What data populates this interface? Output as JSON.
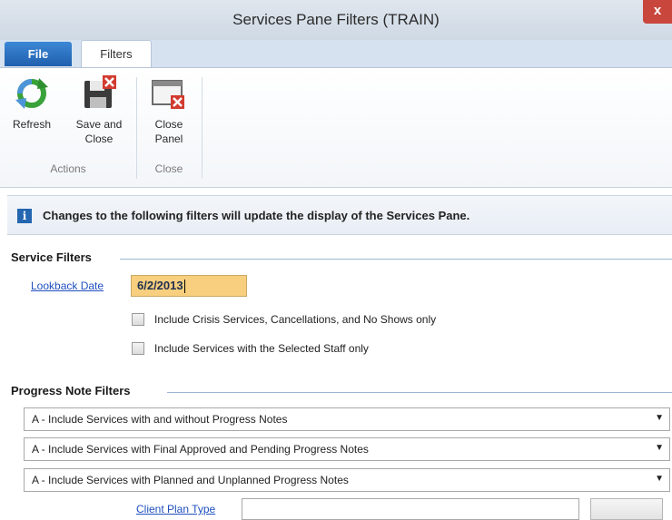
{
  "window": {
    "title": "Services Pane Filters (TRAIN)",
    "close_glyph": "x"
  },
  "tabs": [
    {
      "label": "File"
    },
    {
      "label": "Filters"
    }
  ],
  "ribbon": {
    "actions_group": "Actions",
    "close_group": "Close",
    "buttons": {
      "refresh": {
        "label": "Refresh",
        "icon": "refresh-icon"
      },
      "save_close": {
        "label_line1": "Save and",
        "label_line2": "Close",
        "icon": "save-close-icon"
      },
      "close_panel": {
        "label_line1": "Close",
        "label_line2": "Panel",
        "icon": "close-panel-icon"
      }
    }
  },
  "info": {
    "icon_glyph": "i",
    "message": "Changes to the following filters will update the display of the Services Pane."
  },
  "service_filters": {
    "title": "Service Filters",
    "lookback_label": "Lookback Date",
    "lookback_value": "6/2/2013",
    "include_crisis": {
      "label": "Include Crisis Services, Cancellations, and No Shows only",
      "checked": false
    },
    "include_staff": {
      "label": "Include Services with the Selected Staff only",
      "checked": false
    }
  },
  "progress_note_filters": {
    "title": "Progress Note Filters",
    "dropdowns": [
      {
        "value": "A - Include Services with and without Progress Notes"
      },
      {
        "value": "A - Include Services with Final Approved and Pending Progress Notes"
      },
      {
        "value": "A - Include Services with Planned and Unplanned Progress Notes"
      }
    ],
    "client_plan_type_label": "Client Plan Type",
    "client_plan_type_value": ""
  },
  "colors": {
    "file_tab": "#1f5fae",
    "lookback_highlight": "#f8cf7e",
    "link": "#1f4fbf",
    "section_line": "#9bb6d3"
  }
}
